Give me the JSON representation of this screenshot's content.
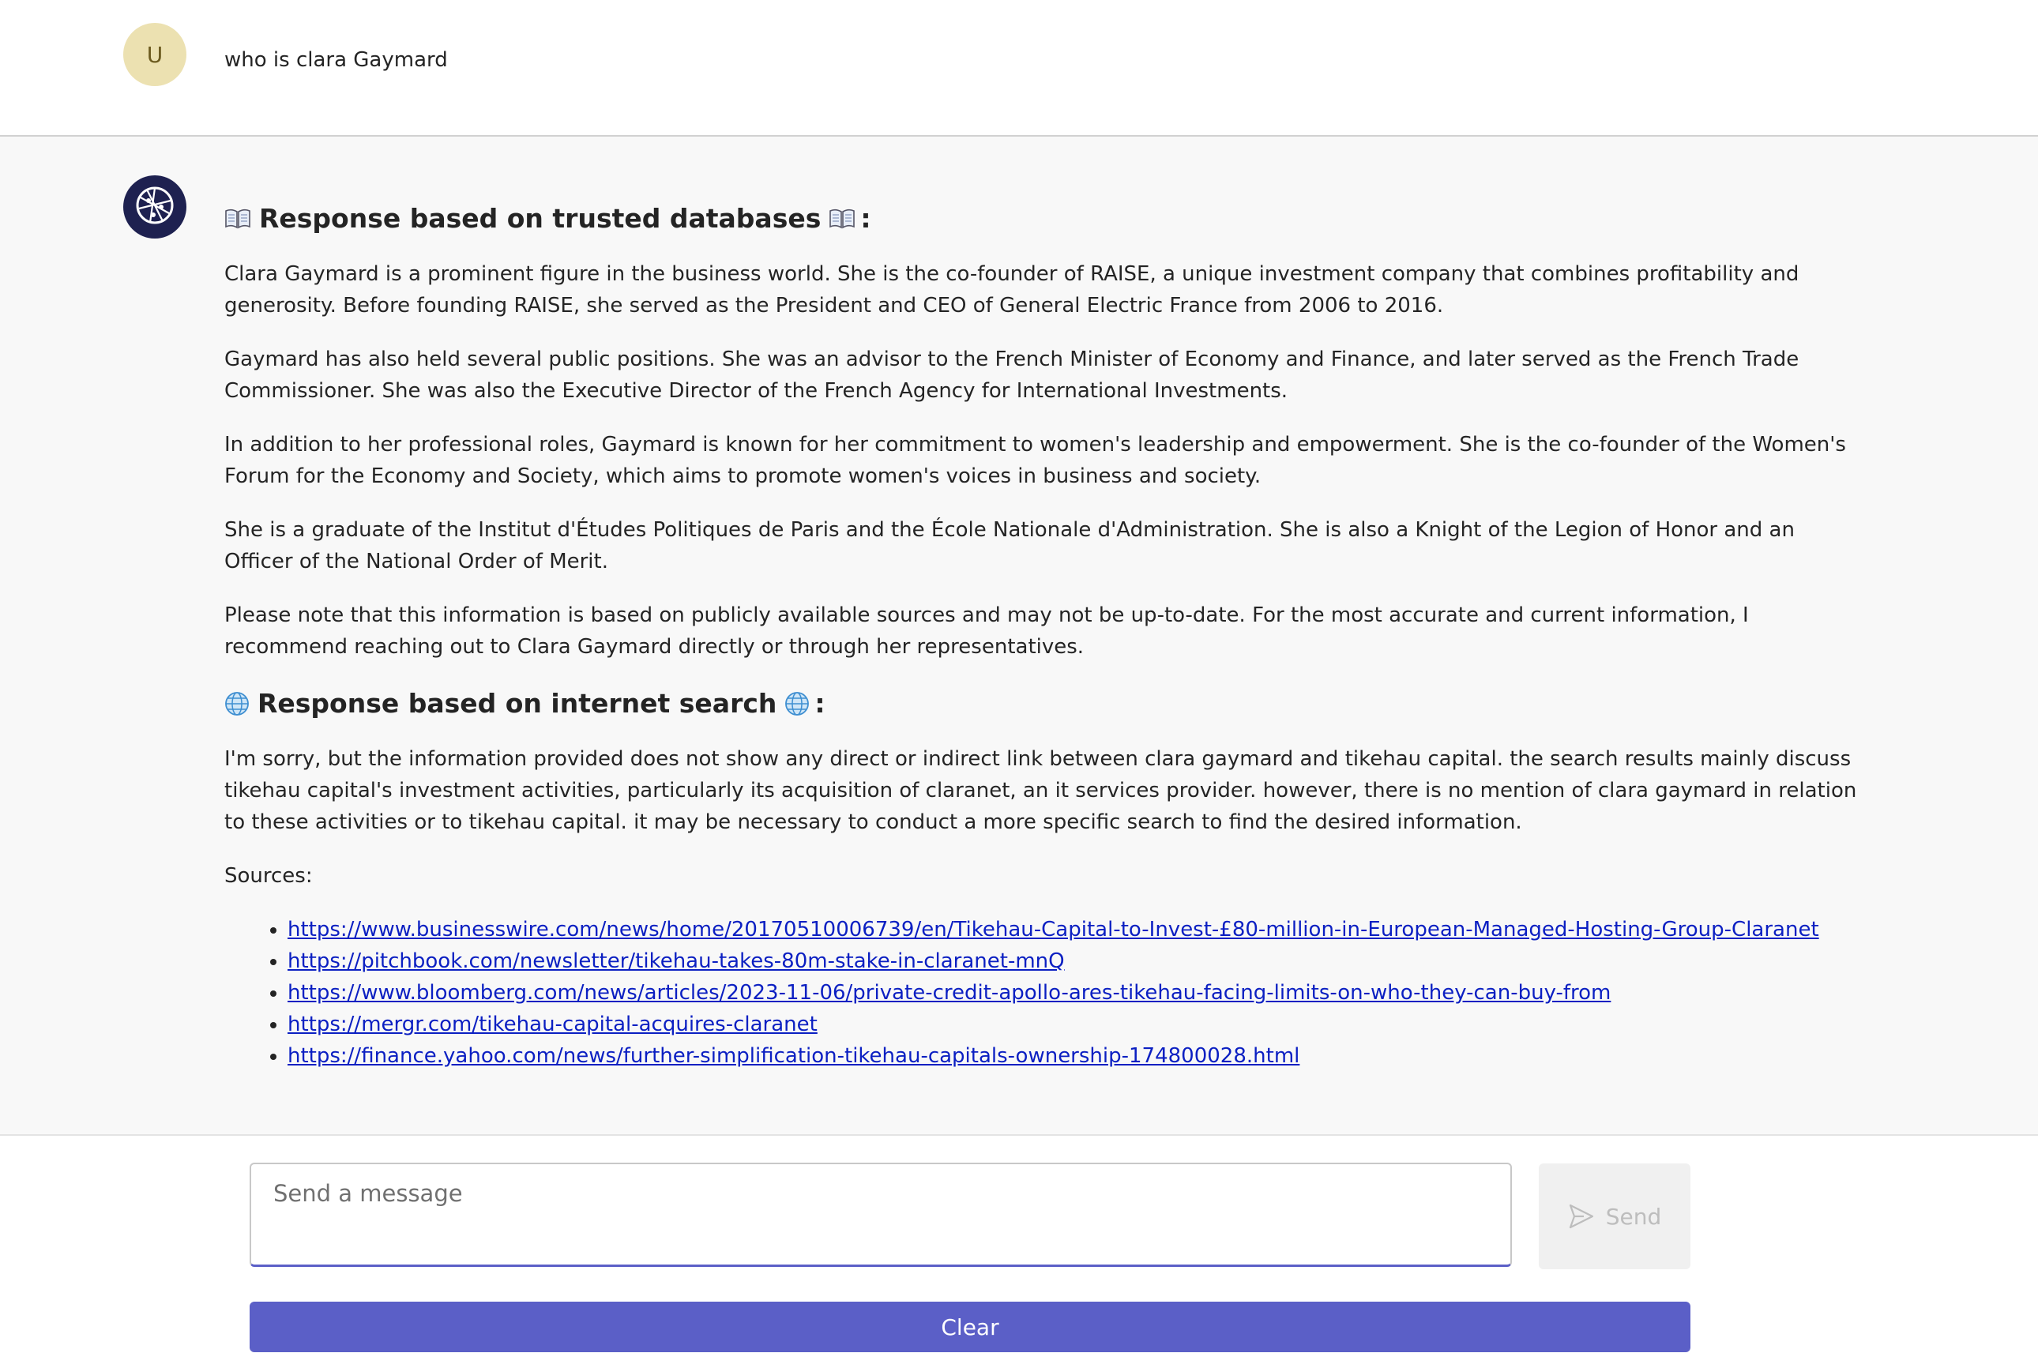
{
  "user_message": {
    "avatar_initial": "U",
    "text": "who is clara Gaymard"
  },
  "assistant_message": {
    "avatar_icon": "globe-network-icon",
    "section1": {
      "icon": "open-book-icon",
      "title": "Response based on trusted databases",
      "suffix": ":",
      "paragraphs": [
        "Clara Gaymard is a prominent figure in the business world. She is the co-founder of RAISE, a unique investment company that combines profitability and generosity. Before founding RAISE, she served as the President and CEO of General Electric France from 2006 to 2016.",
        "Gaymard has also held several public positions. She was an advisor to the French Minister of Economy and Finance, and later served as the French Trade Commissioner. She was also the Executive Director of the French Agency for International Investments.",
        "In addition to her professional roles, Gaymard is known for her commitment to women's leadership and empowerment. She is the co-founder of the Women's Forum for the Economy and Society, which aims to promote women's voices in business and society.",
        "She is a graduate of the Institut d'Études Politiques de Paris and the École Nationale d'Administration. She is also a Knight of the Legion of Honor and an Officer of the National Order of Merit.",
        "Please note that this information is based on publicly available sources and may not be up-to-date. For the most accurate and current information, I recommend reaching out to Clara Gaymard directly or through her representatives."
      ]
    },
    "section2": {
      "icon": "globe-icon",
      "title": "Response based on internet search",
      "suffix": ":",
      "paragraph": "I'm sorry, but the information provided does not show any direct or indirect link between clara gaymard and tikehau capital. the search results mainly discuss tikehau capital's investment activities, particularly its acquisition of claranet, an it services provider. however, there is no mention of clara gaymard in relation to these activities or to tikehau capital. it may be necessary to conduct a more specific search to find the desired information.",
      "sources_label": "Sources:",
      "sources": [
        "https://www.businesswire.com/news/home/20170510006739/en/Tikehau-Capital-to-Invest-£80-million-in-European-Managed-Hosting-Group-Claranet",
        "https://pitchbook.com/newsletter/tikehau-takes-80m-stake-in-claranet-mnQ",
        "https://www.bloomberg.com/news/articles/2023-11-06/private-credit-apollo-ares-tikehau-facing-limits-on-who-they-can-buy-from",
        "https://mergr.com/tikehau-capital-acquires-claranet",
        "https://finance.yahoo.com/news/further-simplification-tikehau-capitals-ownership-174800028.html"
      ]
    }
  },
  "composer": {
    "placeholder": "Send a message",
    "value": "",
    "send_label": "Send",
    "clear_label": "Clear"
  },
  "colors": {
    "accent": "#5b5fc7",
    "user_avatar_bg": "#ece1b1",
    "bot_avatar_bg": "#1e2150",
    "link": "#0b1fc2",
    "assistant_bg": "#f8f8f8"
  }
}
